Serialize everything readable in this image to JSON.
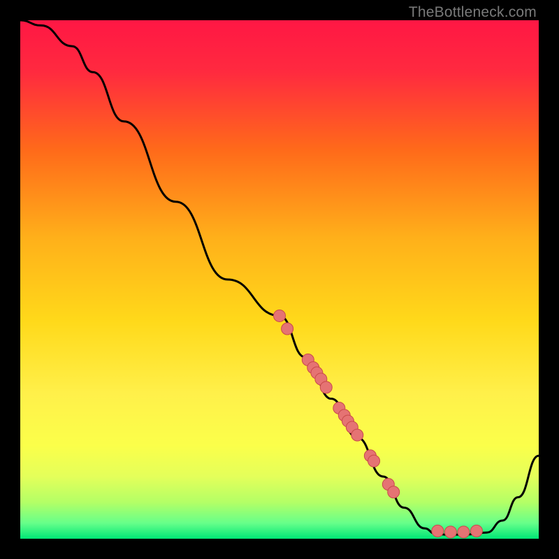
{
  "watermark": "TheBottleneck.com",
  "colors": {
    "gradient_top": "#ff1744",
    "gradient_mid_upper": "#ff7a1a",
    "gradient_mid": "#ffd31a",
    "gradient_mid_lower": "#fff04a",
    "gradient_low": "#d6ff4a",
    "gradient_bottom": "#00e676",
    "curve": "#000000",
    "dot_fill": "#e57373",
    "dot_stroke": "#c94a4a"
  },
  "chart_data": {
    "type": "line",
    "title": "",
    "xlabel": "",
    "ylabel": "",
    "xlim": [
      0,
      100
    ],
    "ylim": [
      0,
      100
    ],
    "curve": [
      {
        "x": 0,
        "y": 100
      },
      {
        "x": 4,
        "y": 99
      },
      {
        "x": 10,
        "y": 95
      },
      {
        "x": 14,
        "y": 90
      },
      {
        "x": 20,
        "y": 80.5
      },
      {
        "x": 30,
        "y": 65
      },
      {
        "x": 40,
        "y": 50
      },
      {
        "x": 50,
        "y": 43
      },
      {
        "x": 55,
        "y": 35
      },
      {
        "x": 60,
        "y": 27
      },
      {
        "x": 65,
        "y": 19.5
      },
      {
        "x": 70,
        "y": 12
      },
      {
        "x": 74,
        "y": 6
      },
      {
        "x": 78,
        "y": 2
      },
      {
        "x": 80,
        "y": 1
      },
      {
        "x": 82,
        "y": 0.8
      },
      {
        "x": 86,
        "y": 0.8
      },
      {
        "x": 90,
        "y": 1.2
      },
      {
        "x": 93,
        "y": 3.5
      },
      {
        "x": 96,
        "y": 8
      },
      {
        "x": 100,
        "y": 16
      }
    ],
    "dots": [
      {
        "x": 50.0,
        "y": 43.0
      },
      {
        "x": 51.5,
        "y": 40.5
      },
      {
        "x": 55.5,
        "y": 34.5
      },
      {
        "x": 56.5,
        "y": 33.0
      },
      {
        "x": 57.2,
        "y": 32.0
      },
      {
        "x": 58.0,
        "y": 30.8
      },
      {
        "x": 59.0,
        "y": 29.2
      },
      {
        "x": 61.5,
        "y": 25.2
      },
      {
        "x": 62.5,
        "y": 23.8
      },
      {
        "x": 63.2,
        "y": 22.7
      },
      {
        "x": 64.0,
        "y": 21.5
      },
      {
        "x": 65.0,
        "y": 20.0
      },
      {
        "x": 67.5,
        "y": 16.0
      },
      {
        "x": 68.2,
        "y": 15.0
      },
      {
        "x": 71.0,
        "y": 10.5
      },
      {
        "x": 72.0,
        "y": 9.0
      },
      {
        "x": 80.5,
        "y": 1.5
      },
      {
        "x": 83.0,
        "y": 1.3
      },
      {
        "x": 85.5,
        "y": 1.3
      },
      {
        "x": 88.0,
        "y": 1.5
      }
    ]
  }
}
